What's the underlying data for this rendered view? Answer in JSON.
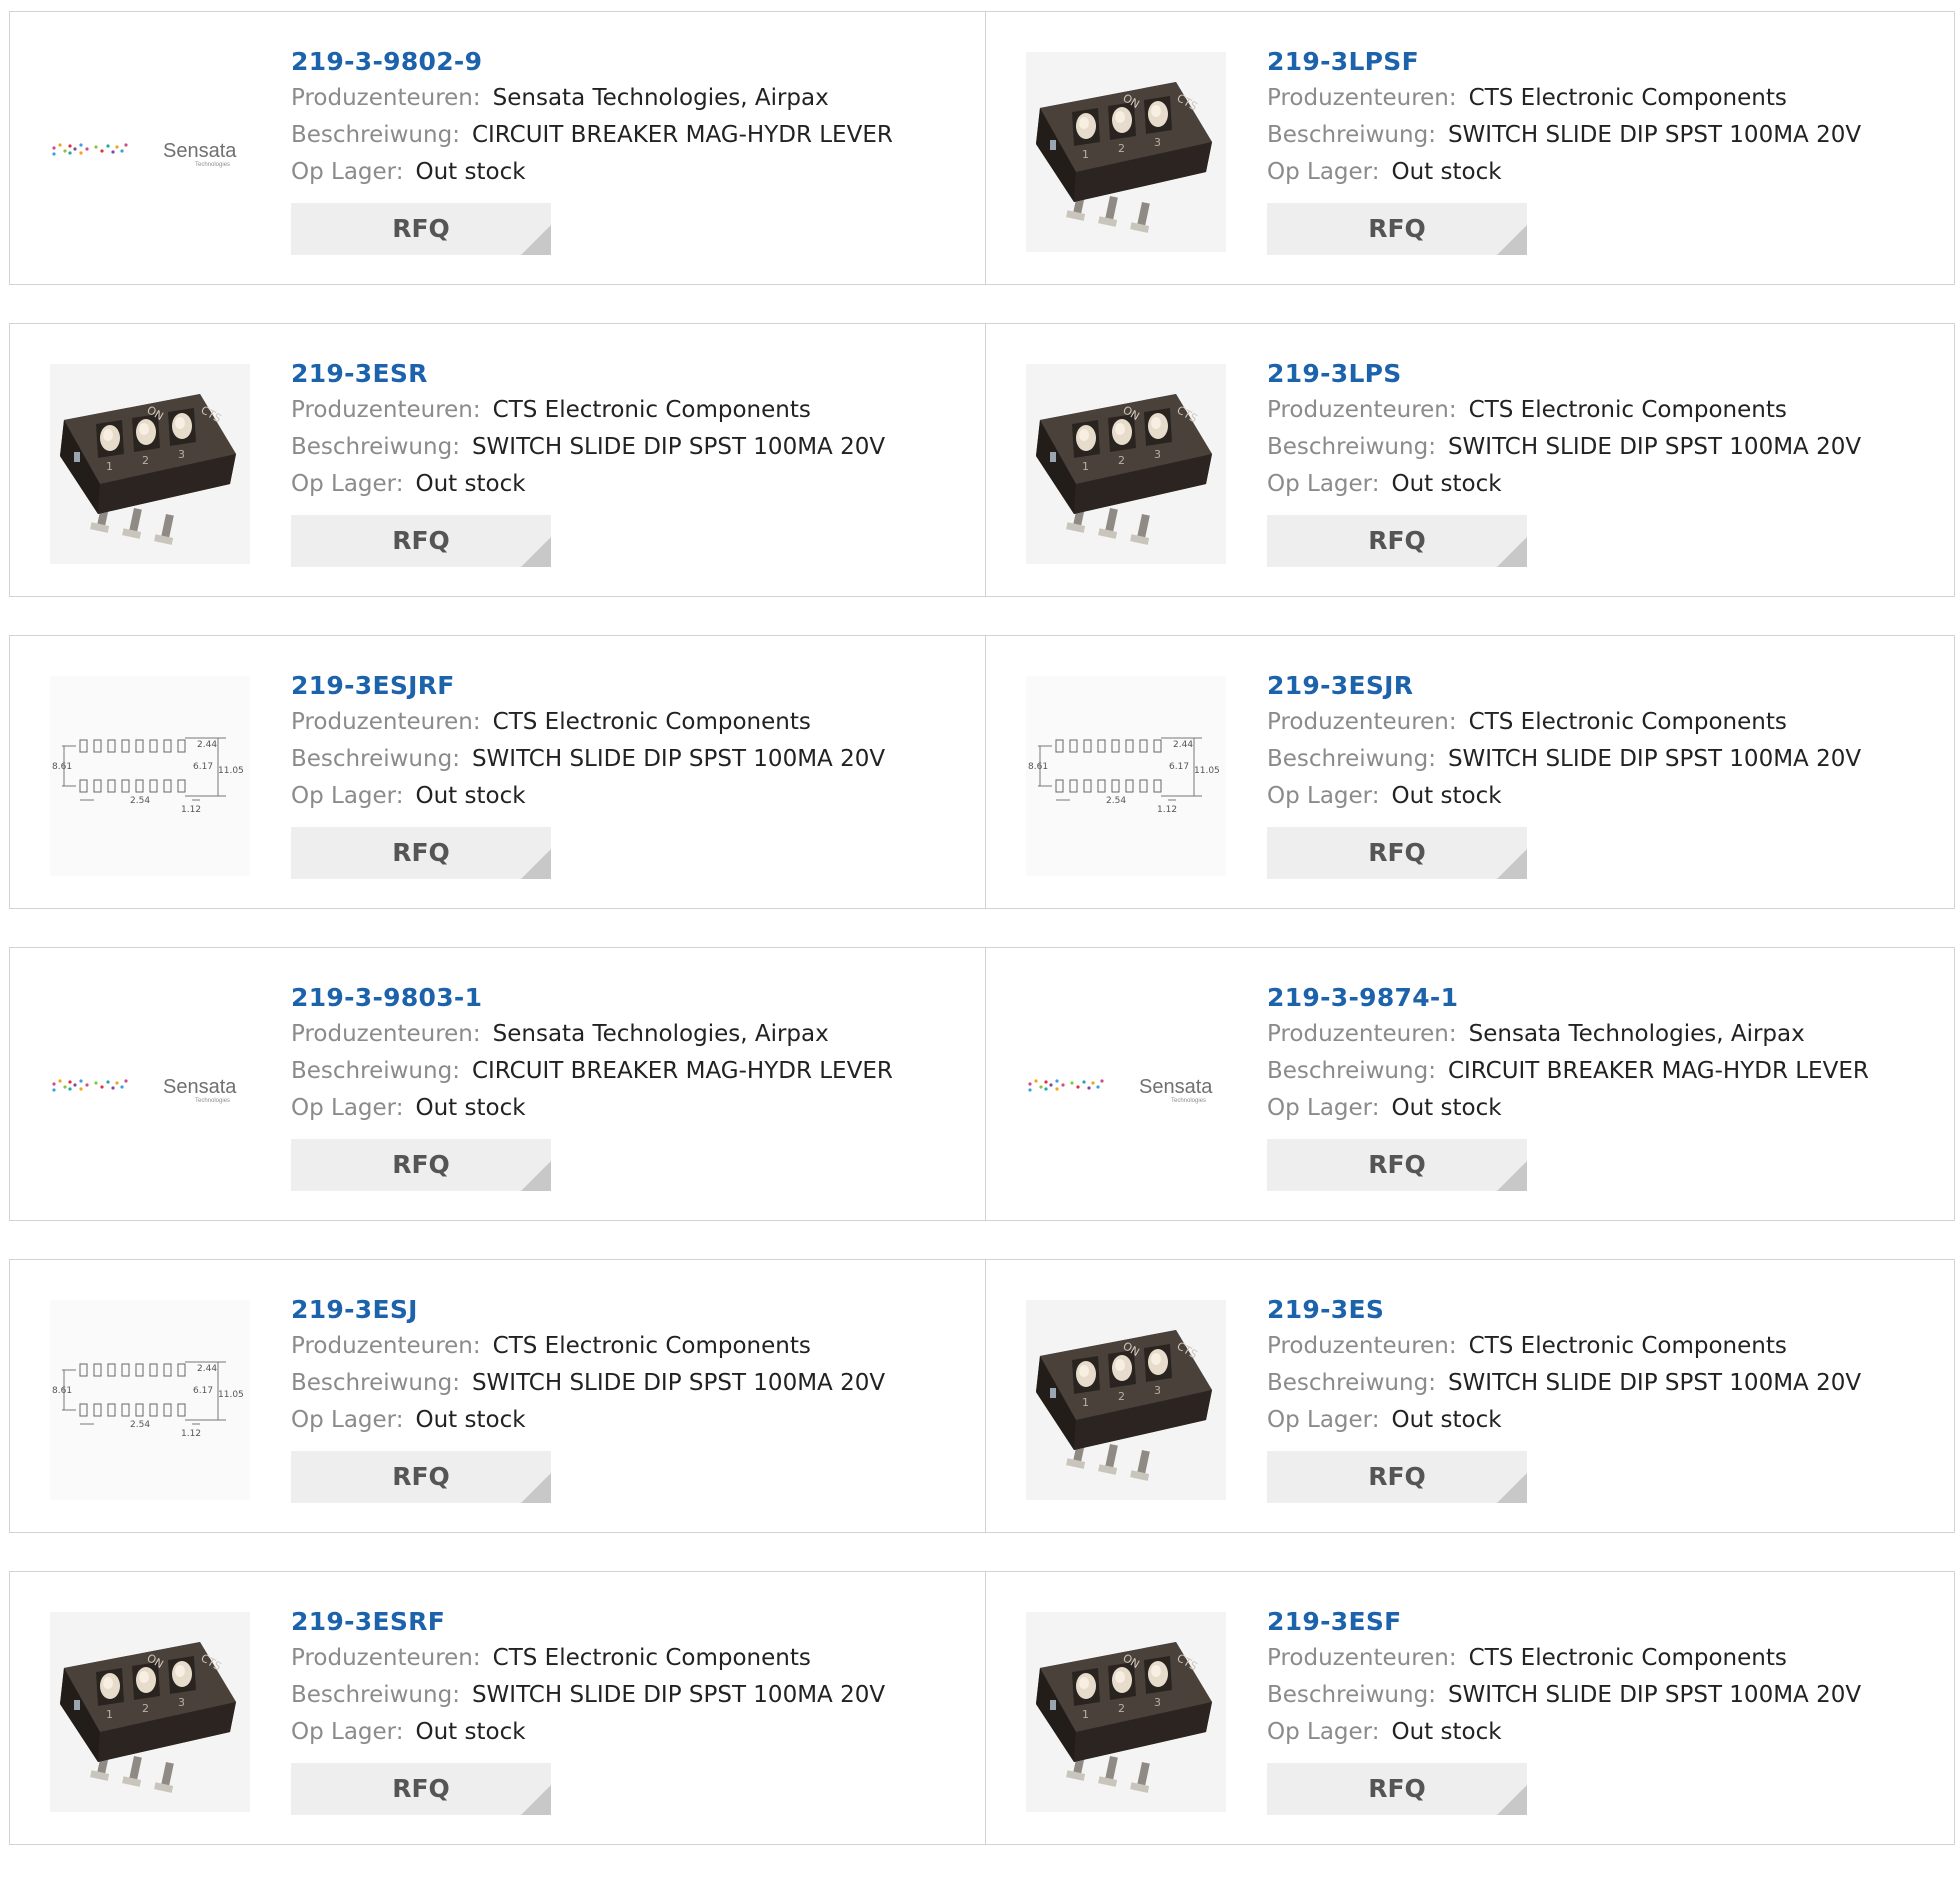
{
  "labels": {
    "manufacturer": "Produzenteuren:",
    "description": "Beschreiwung:",
    "stock": "Op Lager:",
    "rfq": "RFQ"
  },
  "sensata_logo": {
    "brand": "Sensata",
    "tagline": "Technologies"
  },
  "drawing": {
    "dims": [
      "2.44",
      "8.61",
      "6.17",
      "11.05",
      "2.54",
      "1.12"
    ]
  },
  "dip_switch": {
    "on": "ON",
    "brand": "CTS",
    "numbers": [
      "1",
      "2",
      "3"
    ]
  },
  "colors": {
    "link": "#1c63ab",
    "label": "#8b8b8b",
    "button_bg": "#eeeeee",
    "border": "#d2d2d2"
  },
  "products": [
    {
      "part": "219-3-9802-9",
      "manufacturer": "Sensata Technologies, Airpax",
      "description": "CIRCUIT BREAKER MAG-HYDR LEVER",
      "stock": "Out stock",
      "image": "sensata-logo"
    },
    {
      "part": "219-3LPSF",
      "manufacturer": "CTS Electronic Components",
      "description": "SWITCH SLIDE DIP SPST 100MA 20V",
      "stock": "Out stock",
      "image": "dip-switch"
    },
    {
      "part": "219-3ESR",
      "manufacturer": "CTS Electronic Components",
      "description": "SWITCH SLIDE DIP SPST 100MA 20V",
      "stock": "Out stock",
      "image": "dip-switch"
    },
    {
      "part": "219-3LPS",
      "manufacturer": "CTS Electronic Components",
      "description": "SWITCH SLIDE DIP SPST 100MA 20V",
      "stock": "Out stock",
      "image": "dip-switch"
    },
    {
      "part": "219-3ESJRF",
      "manufacturer": "CTS Electronic Components",
      "description": "SWITCH SLIDE DIP SPST 100MA 20V",
      "stock": "Out stock",
      "image": "drawing"
    },
    {
      "part": "219-3ESJR",
      "manufacturer": "CTS Electronic Components",
      "description": "SWITCH SLIDE DIP SPST 100MA 20V",
      "stock": "Out stock",
      "image": "drawing"
    },
    {
      "part": "219-3-9803-1",
      "manufacturer": "Sensata Technologies, Airpax",
      "description": "CIRCUIT BREAKER MAG-HYDR LEVER",
      "stock": "Out stock",
      "image": "sensata-logo"
    },
    {
      "part": "219-3-9874-1",
      "manufacturer": "Sensata Technologies, Airpax",
      "description": "CIRCUIT BREAKER MAG-HYDR LEVER",
      "stock": "Out stock",
      "image": "sensata-logo"
    },
    {
      "part": "219-3ESJ",
      "manufacturer": "CTS Electronic Components",
      "description": "SWITCH SLIDE DIP SPST 100MA 20V",
      "stock": "Out stock",
      "image": "drawing"
    },
    {
      "part": "219-3ES",
      "manufacturer": "CTS Electronic Components",
      "description": "SWITCH SLIDE DIP SPST 100MA 20V",
      "stock": "Out stock",
      "image": "dip-switch"
    },
    {
      "part": "219-3ESRF",
      "manufacturer": "CTS Electronic Components",
      "description": "SWITCH SLIDE DIP SPST 100MA 20V",
      "stock": "Out stock",
      "image": "dip-switch"
    },
    {
      "part": "219-3ESF",
      "manufacturer": "CTS Electronic Components",
      "description": "SWITCH SLIDE DIP SPST 100MA 20V",
      "stock": "Out stock",
      "image": "dip-switch"
    }
  ]
}
